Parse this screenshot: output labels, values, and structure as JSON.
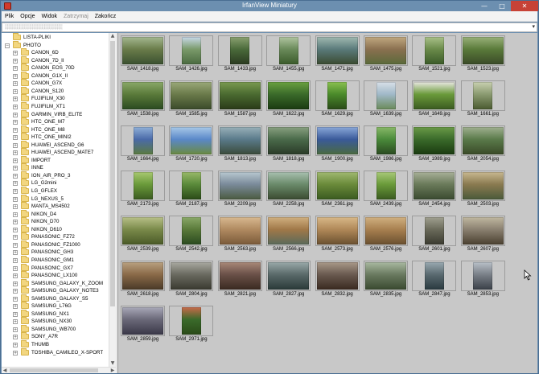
{
  "window": {
    "title": "IrfanView Miniatury",
    "minimize_label": "—",
    "maximize_label": "□",
    "close_label": "✕"
  },
  "menu": [
    {
      "label": "Plik",
      "disabled": false
    },
    {
      "label": "Opcje",
      "disabled": false
    },
    {
      "label": "Widok",
      "disabled": false
    },
    {
      "label": "Zatrzymaj",
      "disabled": true
    },
    {
      "label": "Zakończ",
      "disabled": false
    }
  ],
  "path": {
    "value": "░░░░░░░░░░░░░░░░░░░░░░░",
    "dropdown_icon": "chevron-down-icon"
  },
  "tree": {
    "items": [
      {
        "label": "LISTA-PLIKI",
        "level": 1,
        "expander": ""
      },
      {
        "label": "PHOTO",
        "level": 1,
        "expander": "−"
      },
      {
        "label": "CANON_6D",
        "level": 2,
        "expander": "+"
      },
      {
        "label": "CANON_7D_II",
        "level": 2,
        "expander": "+"
      },
      {
        "label": "CANON_EOS_70D",
        "level": 2,
        "expander": "+"
      },
      {
        "label": "CANON_G1X_II",
        "level": 2,
        "expander": "+"
      },
      {
        "label": "CANON_G7X",
        "level": 2,
        "expander": "+"
      },
      {
        "label": "CANON_S120",
        "level": 2,
        "expander": "+"
      },
      {
        "label": "FUJIFILM_X30",
        "level": 2,
        "expander": "+"
      },
      {
        "label": "FUJIFILM_XT1",
        "level": 2,
        "expander": "+"
      },
      {
        "label": "GARMIN_VIRB_ELITE",
        "level": 2,
        "expander": "+"
      },
      {
        "label": "HTC_ONE_M7",
        "level": 2,
        "expander": "+"
      },
      {
        "label": "HTC_ONE_M8",
        "level": 2,
        "expander": "+"
      },
      {
        "label": "HTC_ONE_MINI2",
        "level": 2,
        "expander": "+"
      },
      {
        "label": "HUAWEI_ASCEND_G6",
        "level": 2,
        "expander": "+"
      },
      {
        "label": "HUAWEI_ASCEND_MATE7",
        "level": 2,
        "expander": "+"
      },
      {
        "label": "IMPORT",
        "level": 2,
        "expander": "+"
      },
      {
        "label": "INNE",
        "level": 2,
        "expander": "+"
      },
      {
        "label": "ION_AIR_PRO_3",
        "level": 2,
        "expander": "+"
      },
      {
        "label": "LG_G2mini",
        "level": 2,
        "expander": "+"
      },
      {
        "label": "LG_GFLEX",
        "level": 2,
        "expander": "+"
      },
      {
        "label": "LG_NEXUS_5",
        "level": 2,
        "expander": "+"
      },
      {
        "label": "MANTA_MS4502",
        "level": 2,
        "expander": "+"
      },
      {
        "label": "NIKON_D4",
        "level": 2,
        "expander": "+"
      },
      {
        "label": "NIKON_D70",
        "level": 2,
        "expander": "+"
      },
      {
        "label": "NIKON_D610",
        "level": 2,
        "expander": "+"
      },
      {
        "label": "PANASONIC_FZ72",
        "level": 2,
        "expander": "+"
      },
      {
        "label": "PANASONIC_FZ1000",
        "level": 2,
        "expander": "+"
      },
      {
        "label": "PANASONIC_GH3",
        "level": 2,
        "expander": "+"
      },
      {
        "label": "PANASONIC_GM1",
        "level": 2,
        "expander": "+"
      },
      {
        "label": "PANASONIC_GX7",
        "level": 2,
        "expander": "+"
      },
      {
        "label": "PANASONIC_LX100",
        "level": 2,
        "expander": "+"
      },
      {
        "label": "SAMSUNG_GALAXY_K_ZOOM",
        "level": 2,
        "expander": "+"
      },
      {
        "label": "SAMSUNG_GALAXY_NOTE3",
        "level": 2,
        "expander": "+"
      },
      {
        "label": "SAMSUNG_GALAXY_S5",
        "level": 2,
        "expander": "+"
      },
      {
        "label": "SAMSUNG_L76G",
        "level": 2,
        "expander": "+"
      },
      {
        "label": "SAMSUNG_NX1",
        "level": 2,
        "expander": "+"
      },
      {
        "label": "SAMSUNG_NX30",
        "level": 2,
        "expander": "+"
      },
      {
        "label": "SAMSUNG_WB700",
        "level": 2,
        "expander": "+"
      },
      {
        "label": "SONY_A7R",
        "level": 2,
        "expander": "+"
      },
      {
        "label": "THUMB",
        "level": 2,
        "expander": "+"
      },
      {
        "label": "TOSHIBA_CAMILEO_X-SPORT",
        "level": 2,
        "expander": "+"
      }
    ]
  },
  "thumbnails": [
    {
      "name": "SAM_1418.jpg",
      "orientation": "landscape",
      "colors": [
        "#6a7c4a",
        "#a4b890",
        "#3a5030"
      ]
    },
    {
      "name": "SAM_1426.jpg",
      "orientation": "portrait",
      "colors": [
        "#7a9a6a",
        "#c8d8e8",
        "#4a6a40"
      ]
    },
    {
      "name": "SAM_1433.jpg",
      "orientation": "portrait",
      "colors": [
        "#4a6a3a",
        "#8aa070",
        "#2a3a20"
      ]
    },
    {
      "name": "SAM_1455.jpg",
      "orientation": "portrait",
      "colors": [
        "#6a8a5a",
        "#b0c4a0",
        "#3a5a2a"
      ]
    },
    {
      "name": "SAM_1471.jpg",
      "orientation": "landscape",
      "colors": [
        "#5a7a7a",
        "#a0b8b0",
        "#3a4a30"
      ]
    },
    {
      "name": "SAM_1475.jpg",
      "orientation": "landscape",
      "colors": [
        "#8a7050",
        "#c0a880",
        "#5a6a3a"
      ]
    },
    {
      "name": "SAM_1521.jpg",
      "orientation": "portrait",
      "colors": [
        "#6a8a4a",
        "#a8c088",
        "#3a5a28"
      ]
    },
    {
      "name": "SAM_1523.jpg",
      "orientation": "landscape",
      "colors": [
        "#5a7a3a",
        "#98b078",
        "#3a4a28"
      ]
    },
    {
      "name": "SAM_1538.jpg",
      "orientation": "landscape",
      "colors": [
        "#5a7a3a",
        "#8aa868",
        "#2a4a20"
      ]
    },
    {
      "name": "SAM_1585.jpg",
      "orientation": "landscape",
      "colors": [
        "#6a7a4a",
        "#9aa878",
        "#3a4a2a"
      ]
    },
    {
      "name": "SAM_1587.jpg",
      "orientation": "landscape",
      "colors": [
        "#4a6a30",
        "#7a9a50",
        "#2a3a18"
      ]
    },
    {
      "name": "SAM_1622.jpg",
      "orientation": "landscape",
      "colors": [
        "#3a6a2a",
        "#6aa040",
        "#1a3a10"
      ]
    },
    {
      "name": "SAM_1629.jpg",
      "orientation": "portrait",
      "colors": [
        "#4a8a2a",
        "#8ac050",
        "#2a4a18"
      ]
    },
    {
      "name": "SAM_1639.jpg",
      "orientation": "portrait",
      "colors": [
        "#a0b8c8",
        "#d8e0e8",
        "#6a8a5a"
      ]
    },
    {
      "name": "SAM_1649.jpg",
      "orientation": "landscape",
      "colors": [
        "#6a9a3a",
        "#e8e8e0",
        "#3a5a20"
      ]
    },
    {
      "name": "SAM_1661.jpg",
      "orientation": "portrait",
      "colors": [
        "#8a9a70",
        "#c8d0b0",
        "#4a5a30"
      ]
    },
    {
      "name": "SAM_1664.jpg",
      "orientation": "portrait",
      "colors": [
        "#4a6aa8",
        "#90b0d8",
        "#5a7a40"
      ]
    },
    {
      "name": "SAM_1720.jpg",
      "orientation": "landscape",
      "colors": [
        "#5a88c8",
        "#a8c8e8",
        "#6a8a40"
      ]
    },
    {
      "name": "SAM_1813.jpg",
      "orientation": "landscape",
      "colors": [
        "#5a7a8a",
        "#98b0b8",
        "#3a4a3a"
      ]
    },
    {
      "name": "SAM_1818.jpg",
      "orientation": "landscape",
      "colors": [
        "#4a6a4a",
        "#88a080",
        "#2a3a28"
      ]
    },
    {
      "name": "SAM_1900.jpg",
      "orientation": "landscape",
      "colors": [
        "#3a5a9a",
        "#8aa8d8",
        "#4a6a40"
      ]
    },
    {
      "name": "SAM_1986.jpg",
      "orientation": "portrait",
      "colors": [
        "#4a8a3a",
        "#88b868",
        "#2a4a20"
      ]
    },
    {
      "name": "SAM_1989.jpg",
      "orientation": "landscape",
      "colors": [
        "#3a6a2a",
        "#6a9a48",
        "#1a3a10"
      ]
    },
    {
      "name": "SAM_2054.jpg",
      "orientation": "landscape",
      "colors": [
        "#5a7a4a",
        "#a0b090",
        "#3a4a28"
      ]
    },
    {
      "name": "SAM_2173.jpg",
      "orientation": "portrait",
      "colors": [
        "#6a9a3a",
        "#a8c870",
        "#3a5a20"
      ]
    },
    {
      "name": "SAM_2187.jpg",
      "orientation": "portrait",
      "colors": [
        "#5a8a3a",
        "#98b868",
        "#2a4a18"
      ]
    },
    {
      "name": "SAM_2209.jpg",
      "orientation": "landscape",
      "colors": [
        "#7a8a9a",
        "#b8c8d0",
        "#4a5a40"
      ]
    },
    {
      "name": "SAM_2258.jpg",
      "orientation": "landscape",
      "colors": [
        "#6a8a6a",
        "#a8c0b0",
        "#3a4a30"
      ]
    },
    {
      "name": "SAM_2361.jpg",
      "orientation": "landscape",
      "colors": [
        "#6a8a3a",
        "#a0b870",
        "#3a5a20"
      ]
    },
    {
      "name": "SAM_2439.jpg",
      "orientation": "portrait",
      "colors": [
        "#6a9a3a",
        "#a8c878",
        "#3a5a20"
      ]
    },
    {
      "name": "SAM_2454.jpg",
      "orientation": "landscape",
      "colors": [
        "#6a7a5a",
        "#a8b098",
        "#3a4a30"
      ]
    },
    {
      "name": "SAM_2503.jpg",
      "orientation": "landscape",
      "colors": [
        "#8a7a50",
        "#c8b890",
        "#4a5a3a"
      ]
    },
    {
      "name": "SAM_2539.jpg",
      "orientation": "landscape",
      "colors": [
        "#7a8a4a",
        "#b8c088",
        "#4a5a28"
      ]
    },
    {
      "name": "SAM_2542.jpg",
      "orientation": "portrait",
      "colors": [
        "#5a7a3a",
        "#8aa868",
        "#2a4a20"
      ]
    },
    {
      "name": "SAM_2563.jpg",
      "orientation": "landscape",
      "colors": [
        "#b08a60",
        "#d8b890",
        "#7a5a3a"
      ]
    },
    {
      "name": "SAM_2566.jpg",
      "orientation": "landscape",
      "colors": [
        "#a07848",
        "#d0b080",
        "#5a6a5a"
      ]
    },
    {
      "name": "SAM_2573.jpg",
      "orientation": "landscape",
      "colors": [
        "#b08858",
        "#d8b888",
        "#6a5030"
      ]
    },
    {
      "name": "SAM_2576.jpg",
      "orientation": "landscape",
      "colors": [
        "#a88050",
        "#d0b080",
        "#6a5030"
      ]
    },
    {
      "name": "SAM_2601.jpg",
      "orientation": "portrait",
      "colors": [
        "#6a6a5a",
        "#a0a090",
        "#3a3a30"
      ]
    },
    {
      "name": "SAM_2607.jpg",
      "orientation": "landscape",
      "colors": [
        "#8a8070",
        "#c0b8a0",
        "#4a4030"
      ]
    },
    {
      "name": "SAM_2618.jpg",
      "orientation": "landscape",
      "colors": [
        "#8a6a48",
        "#b8a080",
        "#4a3a28"
      ]
    },
    {
      "name": "SAM_2804.jpg",
      "orientation": "landscape",
      "colors": [
        "#6a6a60",
        "#a8a8a0",
        "#3a3a30"
      ]
    },
    {
      "name": "SAM_2821.jpg",
      "orientation": "landscape",
      "colors": [
        "#6a5048",
        "#a88878",
        "#3a2a20"
      ]
    },
    {
      "name": "SAM_2827.jpg",
      "orientation": "landscape",
      "colors": [
        "#5a6a6a",
        "#98a8a8",
        "#2a3a38"
      ]
    },
    {
      "name": "SAM_2832.jpg",
      "orientation": "landscape",
      "colors": [
        "#6a5a50",
        "#a89888",
        "#3a2a20"
      ]
    },
    {
      "name": "SAM_2835.jpg",
      "orientation": "landscape",
      "colors": [
        "#6a7a60",
        "#a8b8a0",
        "#3a4a30"
      ]
    },
    {
      "name": "SAM_2847.jpg",
      "orientation": "portrait",
      "colors": [
        "#5a6a70",
        "#98a8b0",
        "#2a3a40"
      ]
    },
    {
      "name": "SAM_2853.jpg",
      "orientation": "portrait",
      "colors": [
        "#7a8088",
        "#b8c0c8",
        "#3a4048"
      ]
    },
    {
      "name": "SAM_2859.jpg",
      "orientation": "landscape",
      "colors": [
        "#6a6878",
        "#a8a8b8",
        "#3a3848"
      ]
    },
    {
      "name": "SAM_2971.jpg",
      "orientation": "portrait",
      "colors": [
        "#3a6a2a",
        "#c86a4a",
        "#2a4a18"
      ]
    }
  ],
  "colors": {
    "titlebar": "#6c8fb0",
    "close_button": "#c74236",
    "grid_background": "#c8c8c8",
    "folder": "#f2d680"
  }
}
